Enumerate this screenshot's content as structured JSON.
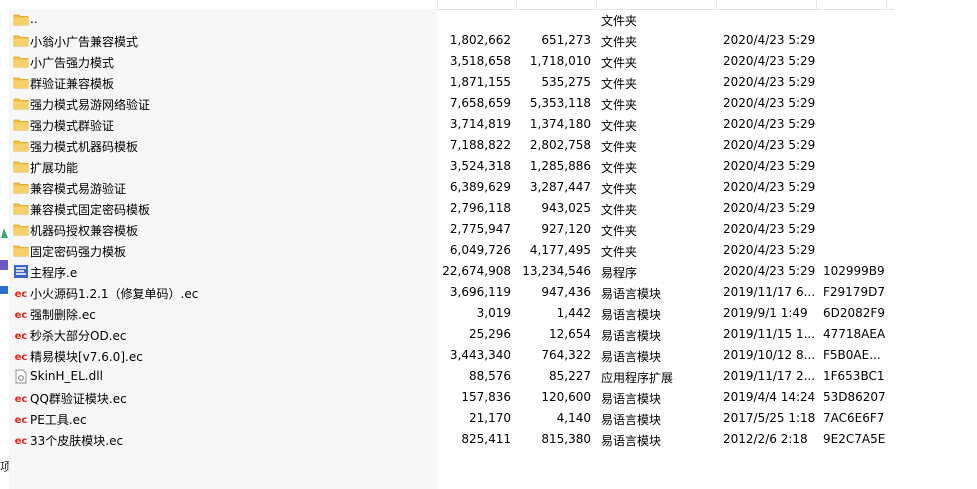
{
  "colors": {
    "folder": "#f0c040",
    "folder_dark": "#d9a21b",
    "ec_red": "#e8231a",
    "exe_blue": "#3a64c8"
  },
  "left_strip": {
    "glyph": "项"
  },
  "rows": [
    {
      "icon": "folder-icon",
      "name": "..",
      "size": "",
      "csize": "",
      "type": "文件夹",
      "date": "",
      "crc": ""
    },
    {
      "icon": "folder-icon",
      "name": "小翁小广告兼容模式",
      "size": "1,802,662",
      "csize": "651,273",
      "type": "文件夹",
      "date": "2020/4/23 5:29",
      "crc": ""
    },
    {
      "icon": "folder-icon",
      "name": "小广告强力模式",
      "size": "3,518,658",
      "csize": "1,718,010",
      "type": "文件夹",
      "date": "2020/4/23 5:29",
      "crc": ""
    },
    {
      "icon": "folder-icon",
      "name": "群验证兼容模板",
      "size": "1,871,155",
      "csize": "535,275",
      "type": "文件夹",
      "date": "2020/4/23 5:29",
      "crc": ""
    },
    {
      "icon": "folder-icon",
      "name": "强力模式易游网络验证",
      "size": "7,658,659",
      "csize": "5,353,118",
      "type": "文件夹",
      "date": "2020/4/23 5:29",
      "crc": ""
    },
    {
      "icon": "folder-icon",
      "name": "强力模式群验证",
      "size": "3,714,819",
      "csize": "1,374,180",
      "type": "文件夹",
      "date": "2020/4/23 5:29",
      "crc": ""
    },
    {
      "icon": "folder-icon",
      "name": "强力模式机器码模板",
      "size": "7,188,822",
      "csize": "2,802,758",
      "type": "文件夹",
      "date": "2020/4/23 5:29",
      "crc": ""
    },
    {
      "icon": "folder-icon",
      "name": "扩展功能",
      "size": "3,524,318",
      "csize": "1,285,886",
      "type": "文件夹",
      "date": "2020/4/23 5:29",
      "crc": ""
    },
    {
      "icon": "folder-icon",
      "name": "兼容模式易游验证",
      "size": "6,389,629",
      "csize": "3,287,447",
      "type": "文件夹",
      "date": "2020/4/23 5:29",
      "crc": ""
    },
    {
      "icon": "folder-icon",
      "name": "兼容模式固定密码模板",
      "size": "2,796,118",
      "csize": "943,025",
      "type": "文件夹",
      "date": "2020/4/23 5:29",
      "crc": ""
    },
    {
      "icon": "folder-icon",
      "name": "机器码授权兼容模板",
      "size": "2,775,947",
      "csize": "927,120",
      "type": "文件夹",
      "date": "2020/4/23 5:29",
      "crc": ""
    },
    {
      "icon": "folder-icon",
      "name": "固定密码强力模板",
      "size": "6,049,726",
      "csize": "4,177,495",
      "type": "文件夹",
      "date": "2020/4/23 5:29",
      "crc": ""
    },
    {
      "icon": "exe-icon",
      "name": "主程序.e",
      "size": "22,674,908",
      "csize": "13,234,546",
      "type": "易程序",
      "date": "2020/4/23 5:29",
      "crc": "102999B9"
    },
    {
      "icon": "ec-module-icon",
      "name": "小火源码1.2.1（修复单码）.ec",
      "size": "3,696,119",
      "csize": "947,436",
      "type": "易语言模块",
      "date": "2019/11/17 6...",
      "crc": "F29179D7"
    },
    {
      "icon": "ec-module-icon",
      "name": "强制删除.ec",
      "size": "3,019",
      "csize": "1,442",
      "type": "易语言模块",
      "date": "2019/9/1 1:49",
      "crc": "6D2082F9"
    },
    {
      "icon": "ec-module-icon",
      "name": "秒杀大部分OD.ec",
      "size": "25,296",
      "csize": "12,654",
      "type": "易语言模块",
      "date": "2019/11/15 1...",
      "crc": "47718AEA"
    },
    {
      "icon": "ec-module-icon",
      "name": "精易模块[v7.6.0].ec",
      "size": "3,443,340",
      "csize": "764,322",
      "type": "易语言模块",
      "date": "2019/10/12 8...",
      "crc": "F5B0AE..."
    },
    {
      "icon": "dll-icon",
      "name": "SkinH_EL.dll",
      "size": "88,576",
      "csize": "85,227",
      "type": "应用程序扩展",
      "date": "2019/11/17 2...",
      "crc": "1F653BC1"
    },
    {
      "icon": "ec-module-icon",
      "name": "QQ群验证模块.ec",
      "size": "157,836",
      "csize": "120,600",
      "type": "易语言模块",
      "date": "2019/4/4 14:24",
      "crc": "53D86207"
    },
    {
      "icon": "ec-module-icon",
      "name": "PE工具.ec",
      "size": "21,170",
      "csize": "4,140",
      "type": "易语言模块",
      "date": "2017/5/25 1:18",
      "crc": "7AC6E6F7"
    },
    {
      "icon": "ec-module-icon",
      "name": "33个皮肤模块.ec",
      "size": "825,411",
      "csize": "815,380",
      "type": "易语言模块",
      "date": "2012/2/6 2:18",
      "crc": "9E2C7A5E"
    }
  ]
}
